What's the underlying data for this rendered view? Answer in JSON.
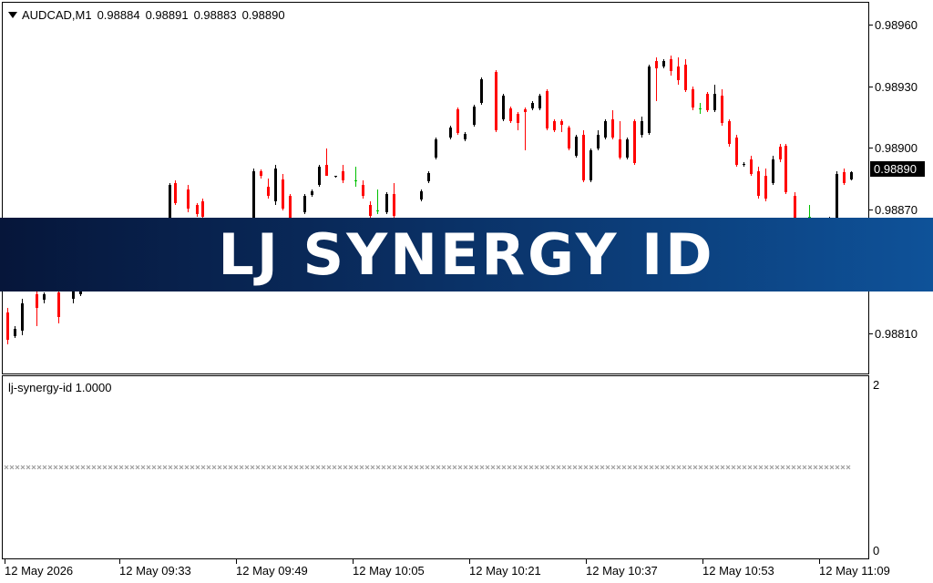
{
  "chart": {
    "symbol": "AUDCAD,M1",
    "ohlc": [
      "0.98884",
      "0.98891",
      "0.98883",
      "0.98890"
    ],
    "current_price": "0.98890",
    "price_labels": [
      {
        "text": "0.98960",
        "value": 0.9896
      },
      {
        "text": "0.98930",
        "value": 0.9893
      },
      {
        "text": "0.98900",
        "value": 0.989
      },
      {
        "text": "0.98870",
        "value": 0.9887
      },
      {
        "text": "0.98810",
        "value": 0.9881
      }
    ],
    "time_labels": [
      "12 May 2026",
      "12 May 09:33",
      "12 May 09:49",
      "12 May 10:05",
      "12 May 10:21",
      "12 May 10:37",
      "12 May 10:53",
      "12 May 11:09"
    ],
    "colors": {
      "bull": "#000000",
      "bear": "#ff0000",
      "doji": "#00c000"
    }
  },
  "indicator": {
    "label": "lj-synergy-id 1.0000",
    "scale_top": "2",
    "scale_bottom": "0",
    "value": 1,
    "marker_color": "#a0a0a0"
  },
  "banner": {
    "text": "LJ SYNERGY ID"
  }
}
